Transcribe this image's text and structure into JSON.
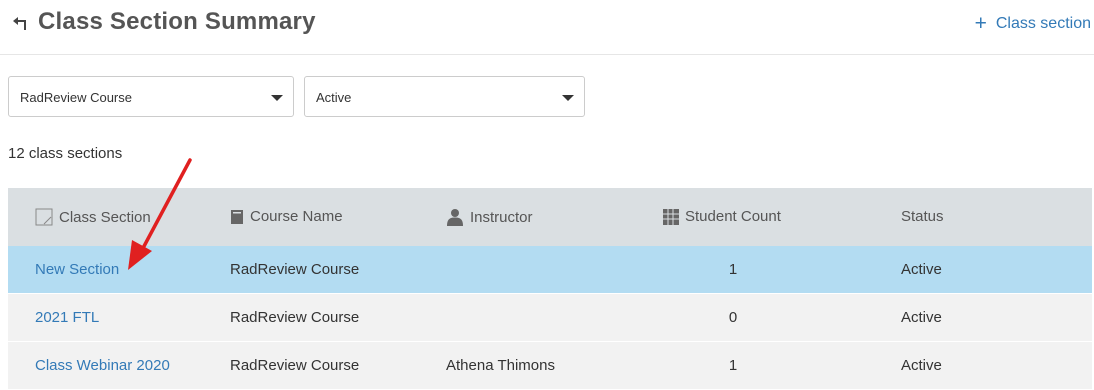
{
  "header": {
    "title": "Class Section Summary",
    "back_icon": "back-arrow-icon",
    "add_icon": "plus-icon",
    "add_label": "Class section"
  },
  "filters": {
    "course": {
      "value": "RadReview Course"
    },
    "status": {
      "value": "Active"
    }
  },
  "summary": {
    "count_text": "12 class sections"
  },
  "table": {
    "columns": [
      {
        "label": "Class Section",
        "icon": "class-section-icon"
      },
      {
        "label": "Course Name",
        "icon": "book-icon"
      },
      {
        "label": "Instructor",
        "icon": "user-icon"
      },
      {
        "label": "Student Count",
        "icon": "grid-icon"
      },
      {
        "label": "Status",
        "icon": ""
      }
    ],
    "rows": [
      {
        "section": "New Section",
        "course": "RadReview Course",
        "instructor": "",
        "count": "1",
        "status": "Active"
      },
      {
        "section": "2021 FTL",
        "course": "RadReview Course",
        "instructor": "",
        "count": "0",
        "status": "Active"
      },
      {
        "section": "Class Webinar 2020",
        "course": "RadReview Course",
        "instructor": "Athena Thimons",
        "count": "1",
        "status": "Active"
      }
    ]
  },
  "colors": {
    "link": "#337ab7",
    "header_row_bg": "#dadfe2",
    "selected_row_bg": "#b3dcf2",
    "alt_row_bg": "#f2f2f2",
    "annotation_arrow": "#e02020"
  }
}
